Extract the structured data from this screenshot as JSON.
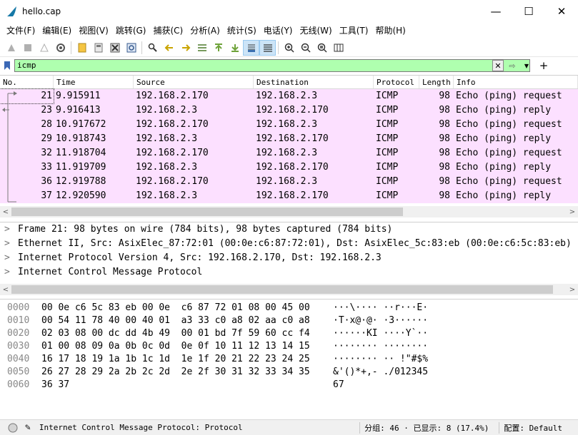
{
  "window": {
    "title": "hello.cap",
    "minimize": "—",
    "maximize": "☐",
    "close": "✕"
  },
  "menu": [
    "文件(F)",
    "编辑(E)",
    "视图(V)",
    "跳转(G)",
    "捕获(C)",
    "分析(A)",
    "统计(S)",
    "电话(Y)",
    "无线(W)",
    "工具(T)",
    "帮助(H)"
  ],
  "filter": {
    "value": "icmp"
  },
  "columns": {
    "no": "No.",
    "time": "Time",
    "source": "Source",
    "destination": "Destination",
    "protocol": "Protocol",
    "length": "Length",
    "info": "Info"
  },
  "packets": [
    {
      "no": "21",
      "time": "9.915911",
      "source": "192.168.2.170",
      "destination": "192.168.2.3",
      "protocol": "ICMP",
      "length": "98",
      "info": "Echo (ping) request"
    },
    {
      "no": "23",
      "time": "9.916413",
      "source": "192.168.2.3",
      "destination": "192.168.2.170",
      "protocol": "ICMP",
      "length": "98",
      "info": "Echo (ping) reply"
    },
    {
      "no": "28",
      "time": "10.917672",
      "source": "192.168.2.170",
      "destination": "192.168.2.3",
      "protocol": "ICMP",
      "length": "98",
      "info": "Echo (ping) request"
    },
    {
      "no": "29",
      "time": "10.918743",
      "source": "192.168.2.3",
      "destination": "192.168.2.170",
      "protocol": "ICMP",
      "length": "98",
      "info": "Echo (ping) reply"
    },
    {
      "no": "32",
      "time": "11.918704",
      "source": "192.168.2.170",
      "destination": "192.168.2.3",
      "protocol": "ICMP",
      "length": "98",
      "info": "Echo (ping) request"
    },
    {
      "no": "33",
      "time": "11.919709",
      "source": "192.168.2.3",
      "destination": "192.168.2.170",
      "protocol": "ICMP",
      "length": "98",
      "info": "Echo (ping) reply"
    },
    {
      "no": "36",
      "time": "12.919788",
      "source": "192.168.2.170",
      "destination": "192.168.2.3",
      "protocol": "ICMP",
      "length": "98",
      "info": "Echo (ping) request"
    },
    {
      "no": "37",
      "time": "12.920590",
      "source": "192.168.2.3",
      "destination": "192.168.2.170",
      "protocol": "ICMP",
      "length": "98",
      "info": "Echo (ping) reply"
    }
  ],
  "details": [
    "Frame 21: 98 bytes on wire (784 bits), 98 bytes captured (784 bits)",
    "Ethernet II, Src: AsixElec_87:72:01 (00:0e:c6:87:72:01), Dst: AsixElec_5c:83:eb (00:0e:c6:5c:83:eb)",
    "Internet Protocol Version 4, Src: 192.168.2.170, Dst: 192.168.2.3",
    "Internet Control Message Protocol"
  ],
  "bytes": [
    {
      "offset": "0000",
      "hex": "00 0e c6 5c 83 eb 00 0e  c6 87 72 01 08 00 45 00",
      "ascii": "···\\···· ··r···E·"
    },
    {
      "offset": "0010",
      "hex": "00 54 11 78 40 00 40 01  a3 33 c0 a8 02 aa c0 a8",
      "ascii": "·T·x@·@· ·3······"
    },
    {
      "offset": "0020",
      "hex": "02 03 08 00 dc dd 4b 49  00 01 bd 7f 59 60 cc f4",
      "ascii": "······KI ····Y`··"
    },
    {
      "offset": "0030",
      "hex": "01 00 08 09 0a 0b 0c 0d  0e 0f 10 11 12 13 14 15",
      "ascii": "········ ········"
    },
    {
      "offset": "0040",
      "hex": "16 17 18 19 1a 1b 1c 1d  1e 1f 20 21 22 23 24 25",
      "ascii": "········ ·· !\"#$%"
    },
    {
      "offset": "0050",
      "hex": "26 27 28 29 2a 2b 2c 2d  2e 2f 30 31 32 33 34 35",
      "ascii": "&'()*+,- ./012345"
    },
    {
      "offset": "0060",
      "hex": "36 37",
      "ascii": "67"
    }
  ],
  "status": {
    "field": "Internet Control Message Protocol: Protocol",
    "packets": "分组: 46 · 已显示: 8 (17.4%)",
    "profile": "配置: Default"
  },
  "colors": {
    "row_bg": "#fce0ff",
    "filter_bg": "#afffaf"
  }
}
